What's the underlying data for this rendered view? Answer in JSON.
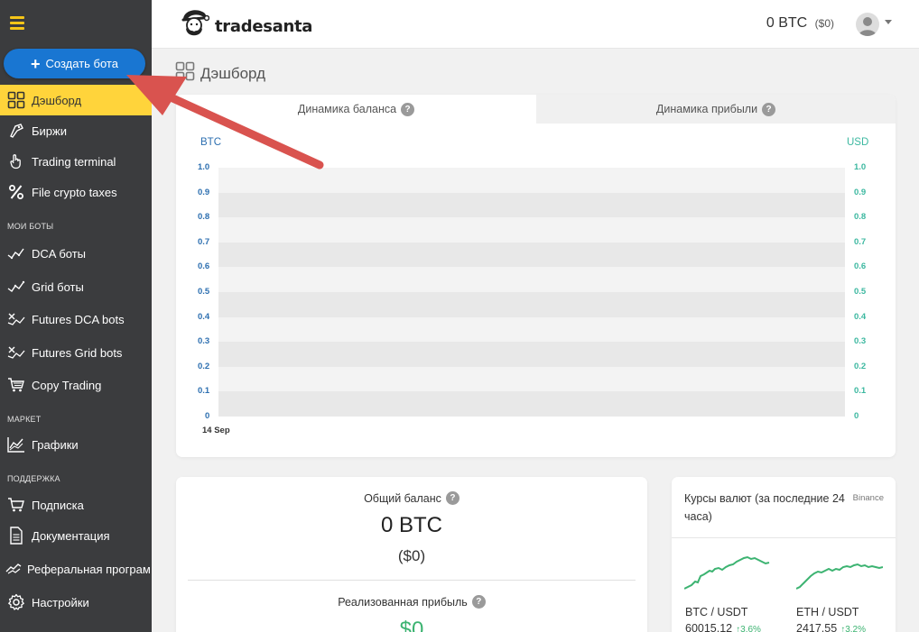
{
  "sidebar": {
    "create_bot_label": "Создать бота",
    "items": [
      {
        "label": "Дэшборд",
        "icon": "dashboard-grid-icon",
        "active": true
      },
      {
        "label": "Биржи",
        "icon": "exchange-icon"
      },
      {
        "label": "Trading terminal",
        "icon": "hand-pointer-icon"
      },
      {
        "label": "File crypto taxes",
        "icon": "percent-icon"
      }
    ],
    "sections": {
      "my_bots": "МОИ БОТЫ",
      "market": "МАРКЕТ",
      "support": "ПОДДЕРЖКА"
    },
    "bot_items": [
      {
        "label": "DCA боты",
        "icon": "dca-chart-icon"
      },
      {
        "label": "Grid боты",
        "icon": "grid-chart-icon"
      },
      {
        "label": "Futures DCA bots",
        "icon": "futures-dca-icon"
      },
      {
        "label": "Futures Grid bots",
        "icon": "futures-grid-icon"
      },
      {
        "label": "Copy Trading",
        "icon": "cart-icon"
      }
    ],
    "market_items": [
      {
        "label": "Графики",
        "icon": "chart-line-icon"
      }
    ],
    "support_items": [
      {
        "label": "Подписка",
        "icon": "subscription-cart-icon"
      },
      {
        "label": "Документация",
        "icon": "document-icon"
      },
      {
        "label": "Реферальная програм",
        "icon": "referral-icon"
      },
      {
        "label": "Настройки",
        "icon": "gear-icon"
      }
    ]
  },
  "header": {
    "logo_text": "tradesanta",
    "balance": "0 BTC",
    "balance_usd": "($0)"
  },
  "page": {
    "title": "Дэшборд"
  },
  "chart": {
    "tabs": [
      {
        "label": "Динамика баланса",
        "active": true
      },
      {
        "label": "Динамика прибыли",
        "active": false
      }
    ],
    "left_unit": "BTC",
    "right_unit": "USD",
    "left_color": "#2d6fb0",
    "right_color": "#3cb8a0"
  },
  "chart_data": {
    "type": "area",
    "x": [
      "14 Sep"
    ],
    "series": [],
    "ylim_left": [
      0,
      1.0
    ],
    "ylim_right": [
      0,
      1.0
    ],
    "yticks_left": [
      "1.0",
      "0.9",
      "0.8",
      "0.7",
      "0.6",
      "0.5",
      "0.4",
      "0.3",
      "0.2",
      "0.1",
      "0"
    ],
    "yticks_right": [
      "1.0",
      "0.9",
      "0.8",
      "0.7",
      "0.6",
      "0.5",
      "0.4",
      "0.3",
      "0.2",
      "0.1",
      "0"
    ],
    "xlabel": "",
    "ylabel_left": "BTC",
    "ylabel_right": "USD",
    "grid": "alternating bands"
  },
  "balance_card": {
    "total_label": "Общий баланс",
    "total_value": "0 BTC",
    "total_usd": "($0)",
    "profit_label": "Реализованная прибыль",
    "profit_value": "$0"
  },
  "rates_card": {
    "title": "Курсы валют (за последние 24 часа)",
    "source": "Binance",
    "pairs": [
      {
        "pair": "BTC / USDT",
        "price": "60015.12",
        "change": "3.6%"
      },
      {
        "pair": "ETH / USDT",
        "price": "2417.55",
        "change": "3.2%"
      }
    ]
  }
}
